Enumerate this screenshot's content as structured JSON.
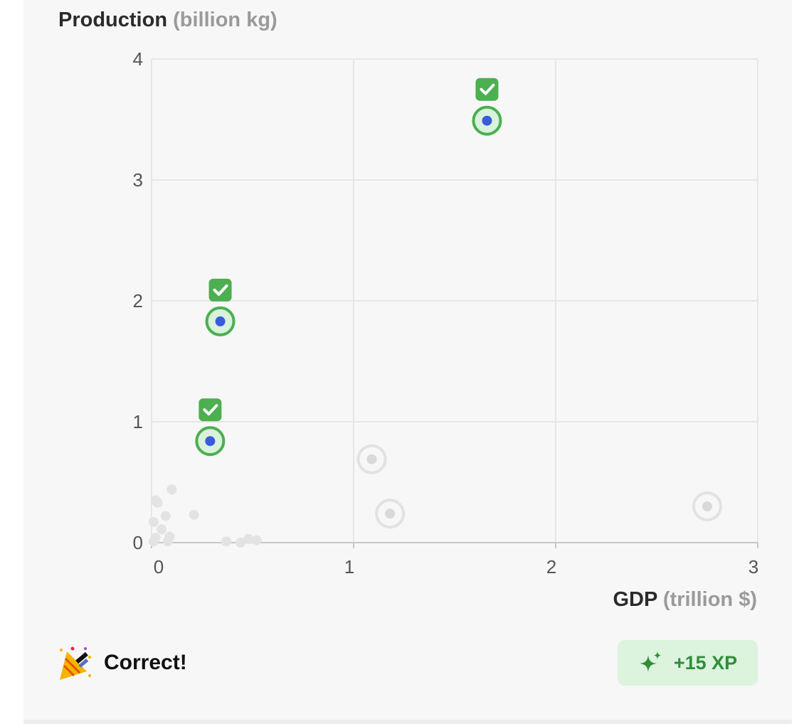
{
  "chart_data": {
    "type": "scatter",
    "ylabel": "Production",
    "ylabel_unit": "(billion kg)",
    "xlabel": "GDP",
    "xlabel_unit": "(trillion $)",
    "xlim": [
      0,
      3
    ],
    "ylim": [
      0,
      4
    ],
    "x_ticks": [
      "0",
      "1",
      "2",
      "3"
    ],
    "y_ticks": [
      "0",
      "1",
      "2",
      "3",
      "4"
    ],
    "grid": true,
    "correct_points": [
      {
        "x": 1.66,
        "y": 3.49
      },
      {
        "x": 0.34,
        "y": 1.83
      },
      {
        "x": 0.29,
        "y": 0.84
      }
    ],
    "unselected_points": [
      {
        "x": 1.09,
        "y": 0.69
      },
      {
        "x": 1.18,
        "y": 0.24
      },
      {
        "x": 2.75,
        "y": 0.3
      }
    ],
    "background_points": [
      {
        "x": 0.02,
        "y": 0.35
      },
      {
        "x": 0.03,
        "y": 0.33
      },
      {
        "x": 0.1,
        "y": 0.44
      },
      {
        "x": 0.07,
        "y": 0.22
      },
      {
        "x": 0.21,
        "y": 0.23
      },
      {
        "x": 0.01,
        "y": 0.17
      },
      {
        "x": 0.05,
        "y": 0.11
      },
      {
        "x": 0.02,
        "y": 0.04
      },
      {
        "x": 0.09,
        "y": 0.05
      },
      {
        "x": 0.01,
        "y": 0.01
      },
      {
        "x": 0.08,
        "y": 0.01
      },
      {
        "x": 0.37,
        "y": 0.01
      },
      {
        "x": 0.44,
        "y": 0.0
      },
      {
        "x": 0.48,
        "y": 0.03
      },
      {
        "x": 0.52,
        "y": 0.02
      }
    ]
  },
  "colors": {
    "correct_ring": "#4caf50",
    "correct_fill": "#d9f2dc",
    "point_dot": "#3b5bdb",
    "check_badge": "#4caf50",
    "muted_ring": "#e2e2e2",
    "muted_dot": "#d9d9d9"
  },
  "feedback": {
    "icon": "party-popper-icon",
    "message": "Correct!"
  },
  "xp_badge": {
    "icon": "sparkle-icon",
    "label": "+15 XP"
  }
}
